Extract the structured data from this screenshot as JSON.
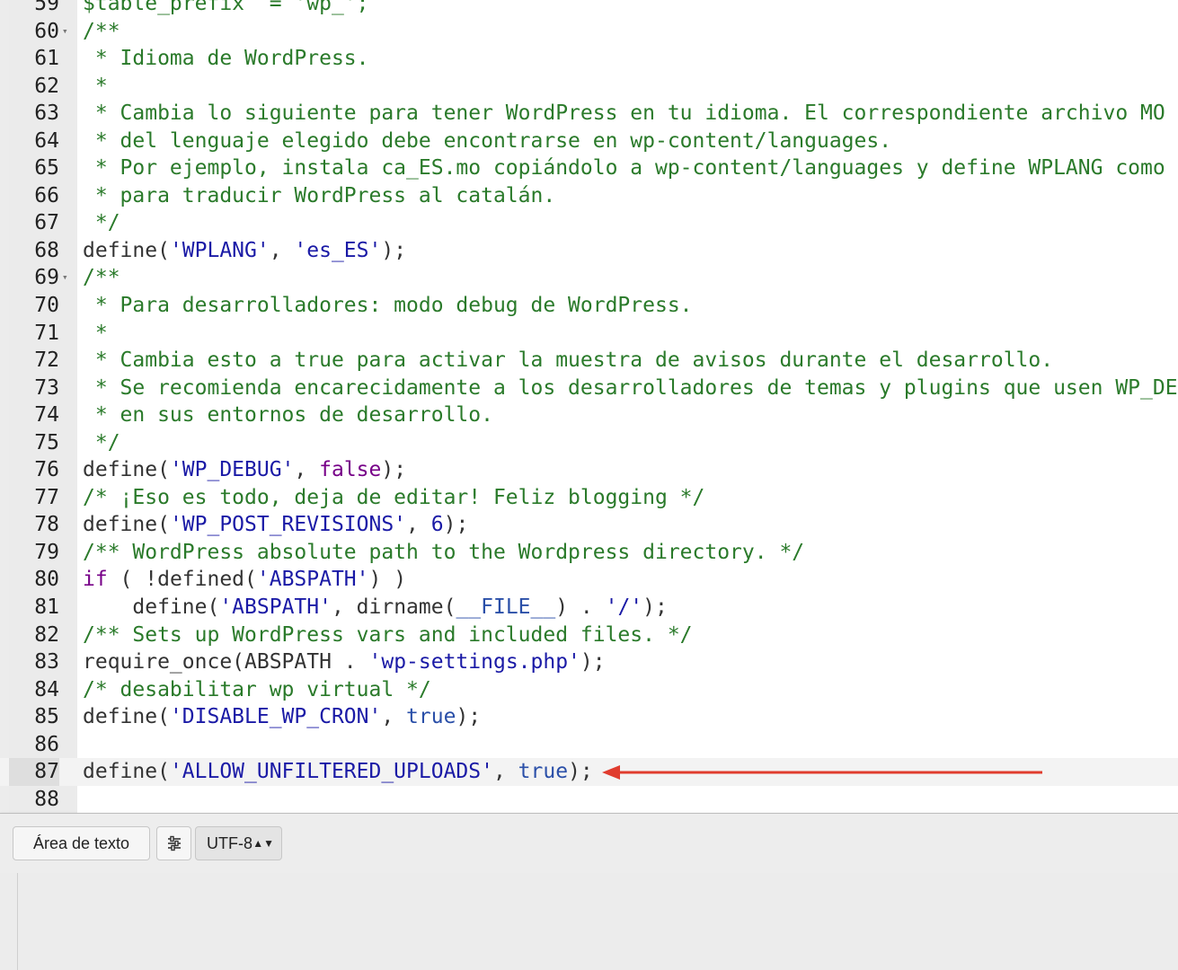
{
  "editor": {
    "lines": [
      {
        "n": "59",
        "fold": false,
        "segs": [
          [
            "cm",
            "$table_prefix  = 'wp_';"
          ]
        ]
      },
      {
        "n": "60",
        "fold": true,
        "segs": [
          [
            "cm",
            "/**"
          ]
        ]
      },
      {
        "n": "61",
        "fold": false,
        "segs": [
          [
            "cm",
            " * Idioma de WordPress."
          ]
        ]
      },
      {
        "n": "62",
        "fold": false,
        "segs": [
          [
            "cm",
            " *"
          ]
        ]
      },
      {
        "n": "63",
        "fold": false,
        "segs": [
          [
            "cm",
            " * Cambia lo siguiente para tener WordPress en tu idioma. El correspondiente archivo MO"
          ]
        ]
      },
      {
        "n": "64",
        "fold": false,
        "segs": [
          [
            "cm",
            " * del lenguaje elegido debe encontrarse en wp-content/languages."
          ]
        ]
      },
      {
        "n": "65",
        "fold": false,
        "segs": [
          [
            "cm",
            " * Por ejemplo, instala ca_ES.mo copiándolo a wp-content/languages y define WPLANG como"
          ]
        ]
      },
      {
        "n": "66",
        "fold": false,
        "segs": [
          [
            "cm",
            " * para traducir WordPress al catalán."
          ]
        ]
      },
      {
        "n": "67",
        "fold": false,
        "segs": [
          [
            "cm",
            " */"
          ]
        ]
      },
      {
        "n": "68",
        "fold": false,
        "segs": [
          [
            "fn",
            "define("
          ],
          [
            "st",
            "'WPLANG'"
          ],
          [
            "fn",
            ", "
          ],
          [
            "st",
            "'es_ES'"
          ],
          [
            "fn",
            ");"
          ]
        ]
      },
      {
        "n": "69",
        "fold": true,
        "segs": [
          [
            "cm",
            "/**"
          ]
        ]
      },
      {
        "n": "70",
        "fold": false,
        "segs": [
          [
            "cm",
            " * Para desarrolladores: modo debug de WordPress."
          ]
        ]
      },
      {
        "n": "71",
        "fold": false,
        "segs": [
          [
            "cm",
            " *"
          ]
        ]
      },
      {
        "n": "72",
        "fold": false,
        "segs": [
          [
            "cm",
            " * Cambia esto a true para activar la muestra de avisos durante el desarrollo."
          ]
        ]
      },
      {
        "n": "73",
        "fold": false,
        "segs": [
          [
            "cm",
            " * Se recomienda encarecidamente a los desarrolladores de temas y plugins que usen WP_DE"
          ]
        ]
      },
      {
        "n": "74",
        "fold": false,
        "segs": [
          [
            "cm",
            " * en sus entornos de desarrollo."
          ]
        ]
      },
      {
        "n": "75",
        "fold": false,
        "segs": [
          [
            "cm",
            " */"
          ]
        ]
      },
      {
        "n": "76",
        "fold": false,
        "segs": [
          [
            "fn",
            "define("
          ],
          [
            "st",
            "'WP_DEBUG'"
          ],
          [
            "fn",
            ", "
          ],
          [
            "kw",
            "false"
          ],
          [
            "fn",
            ");"
          ]
        ]
      },
      {
        "n": "77",
        "fold": false,
        "segs": [
          [
            "cm",
            "/* ¡Eso es todo, deja de editar! Feliz blogging */"
          ]
        ]
      },
      {
        "n": "78",
        "fold": false,
        "segs": [
          [
            "fn",
            "define("
          ],
          [
            "st",
            "'WP_POST_REVISIONS'"
          ],
          [
            "fn",
            ", "
          ],
          [
            "nm",
            "6"
          ],
          [
            "fn",
            ");"
          ]
        ]
      },
      {
        "n": "79",
        "fold": false,
        "segs": [
          [
            "cm",
            "/** WordPress absolute path to the Wordpress directory. */"
          ]
        ]
      },
      {
        "n": "80",
        "fold": false,
        "segs": [
          [
            "kw",
            "if"
          ],
          [
            "fn",
            " ( !defined("
          ],
          [
            "st",
            "'ABSPATH'"
          ],
          [
            "fn",
            ") )"
          ]
        ]
      },
      {
        "n": "81",
        "fold": false,
        "segs": [
          [
            "fn",
            "    define("
          ],
          [
            "st",
            "'ABSPATH'"
          ],
          [
            "fn",
            ", dirname("
          ],
          [
            "bl",
            "__FILE__"
          ],
          [
            "fn",
            ") . "
          ],
          [
            "st",
            "'/'"
          ],
          [
            "fn",
            ");"
          ]
        ]
      },
      {
        "n": "82",
        "fold": false,
        "segs": [
          [
            "cm",
            "/** Sets up WordPress vars and included files. */"
          ]
        ]
      },
      {
        "n": "83",
        "fold": false,
        "segs": [
          [
            "fn",
            "require_once(ABSPATH . "
          ],
          [
            "st",
            "'wp-settings.php'"
          ],
          [
            "fn",
            ");"
          ]
        ]
      },
      {
        "n": "84",
        "fold": false,
        "segs": [
          [
            "cm",
            "/* desabilitar wp virtual */"
          ]
        ]
      },
      {
        "n": "85",
        "fold": false,
        "segs": [
          [
            "fn",
            "define("
          ],
          [
            "st",
            "'DISABLE_WP_CRON'"
          ],
          [
            "fn",
            ", "
          ],
          [
            "bl",
            "true"
          ],
          [
            "fn",
            ");"
          ]
        ]
      },
      {
        "n": "86",
        "fold": false,
        "segs": []
      },
      {
        "n": "87",
        "fold": false,
        "active": true,
        "segs": [
          [
            "fn",
            "define("
          ],
          [
            "st",
            "'ALLOW_UNFILTERED_UPLOADS'"
          ],
          [
            "fn",
            ", "
          ],
          [
            "bl",
            "true"
          ],
          [
            "fn",
            ");"
          ]
        ]
      },
      {
        "n": "88",
        "fold": false,
        "segs": []
      }
    ],
    "fold_marker": "▾",
    "annotation_color": "#e03c2e"
  },
  "statusbar": {
    "mode_label": "Área de texto",
    "settings_icon": "sliders-icon",
    "encoding_value": "UTF-8",
    "encoding_arrows": "▲▼"
  }
}
